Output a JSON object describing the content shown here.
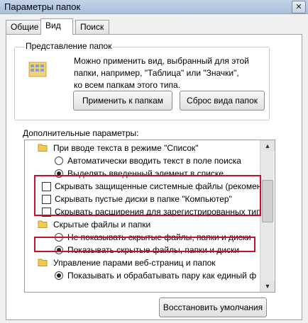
{
  "window": {
    "title": "Параметры папок",
    "close_glyph": "✕"
  },
  "tabs": [
    {
      "label": "Общие"
    },
    {
      "label": "Вид"
    },
    {
      "label": "Поиск"
    }
  ],
  "folder_view": {
    "group_title": "Представление папок",
    "description": [
      "Можно применить вид, выбранный для этой",
      "папки, например, \"Таблица\" или \"Значки\",",
      "ко всем папкам этого типа."
    ],
    "apply_label": "Применить к папкам",
    "reset_label": "Сброс вида папок"
  },
  "advanced": {
    "label": "Дополнительные параметры:",
    "items": [
      {
        "type": "folder",
        "text": "При вводе текста в режиме \"Список\""
      },
      {
        "type": "radio",
        "checked": false,
        "text": "Автоматически вводить текст в поле поиска"
      },
      {
        "type": "radio",
        "checked": true,
        "text": "Выделять введенный элемент в списке"
      },
      {
        "type": "checkbox",
        "checked": false,
        "text": "Скрывать защищенные системные файлы (рекомен"
      },
      {
        "type": "checkbox",
        "checked": false,
        "text": "Скрывать пустые диски в папке \"Компьютер\""
      },
      {
        "type": "checkbox",
        "checked": false,
        "text": "Скрывать расширения для зарегистрированных тип"
      },
      {
        "type": "folder",
        "text": "Скрытые файлы и папки"
      },
      {
        "type": "radio",
        "checked": false,
        "text": "Не показывать скрытые файлы, папки и диски"
      },
      {
        "type": "radio",
        "checked": true,
        "text": "Показывать скрытые файлы, папки и диски"
      },
      {
        "type": "folder",
        "text": "Управление парами веб-страниц и папок"
      },
      {
        "type": "radio",
        "checked": true,
        "text": "Показывать и обрабатывать пару как единый ф"
      }
    ]
  },
  "footer": {
    "restore_label": "Восстановить умолчания"
  },
  "highlight_color": "#c8102e"
}
